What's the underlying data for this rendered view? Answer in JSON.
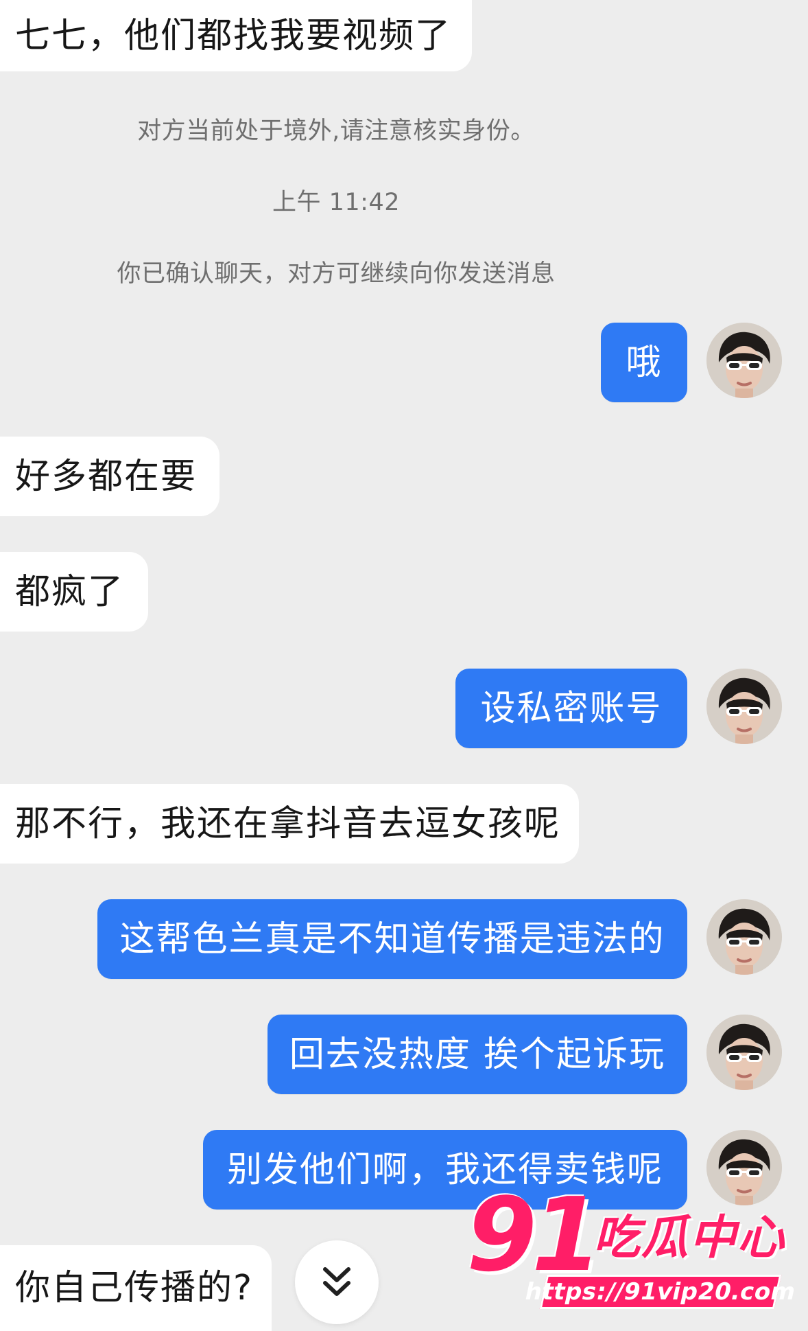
{
  "chat": {
    "system": {
      "location_notice": "对方当前处于境外,请注意核实身份。",
      "timestamp": "上午 11:42",
      "chat_confirmed": "你已确认聊天，对方可继续向你发送消息"
    },
    "messages": [
      {
        "side": "in",
        "text": "七七，他们都找我要视频了"
      },
      {
        "side": "out",
        "text": "哦"
      },
      {
        "side": "in",
        "text": "好多都在要"
      },
      {
        "side": "in",
        "text": "都疯了"
      },
      {
        "side": "out",
        "text": "设私密账号"
      },
      {
        "side": "in",
        "text": "那不行，我还在拿抖音去逗女孩呢"
      },
      {
        "side": "out",
        "text": "这帮色兰真是不知道传播是违法的"
      },
      {
        "side": "out",
        "text": "回去没热度 挨个起诉玩"
      },
      {
        "side": "out",
        "text": "别发他们啊，我还得卖钱呢"
      },
      {
        "side": "in",
        "text": "你自己传播的?"
      }
    ]
  },
  "watermark": {
    "number": "91",
    "name": "吃瓜中心",
    "url": "https://91vip20.com"
  },
  "icons": {
    "scroll_down": "double-chevron-down-icon",
    "avatar": "avatar-with-white-sunglasses"
  },
  "colors": {
    "background": "#ededed",
    "incoming_bubble": "#ffffff",
    "outgoing_bubble": "#2f7af4",
    "system_text": "#6f6f6f",
    "watermark": "#ff1e67"
  }
}
